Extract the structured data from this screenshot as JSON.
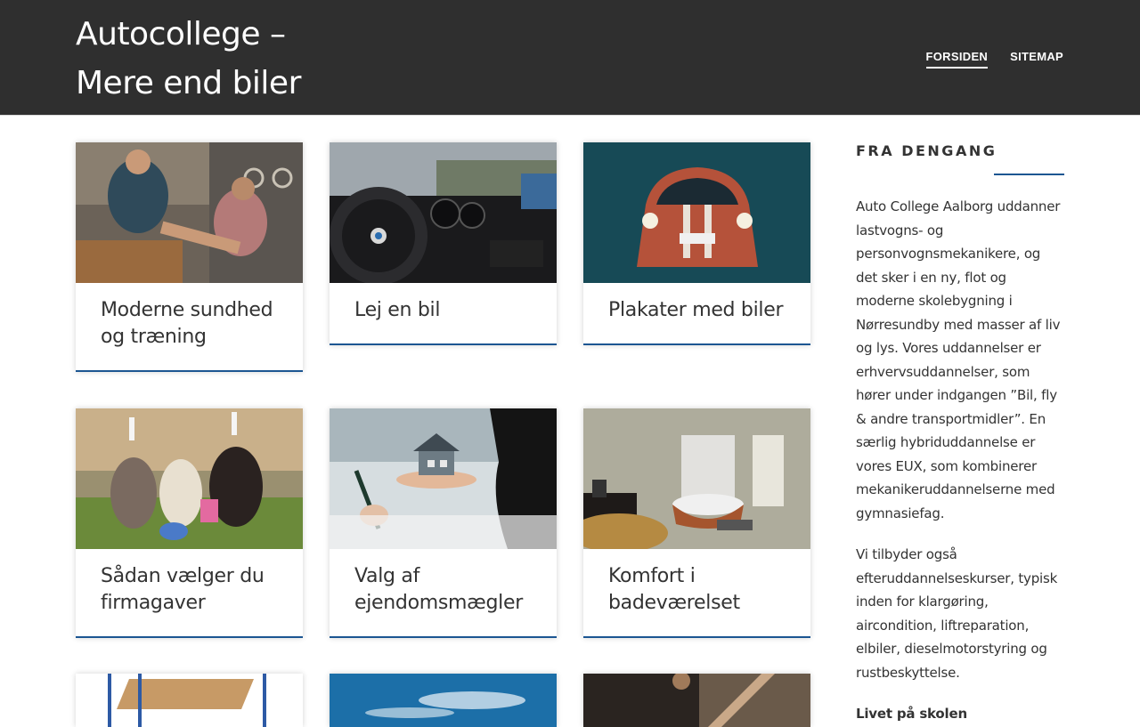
{
  "header": {
    "site_title": "Autocollege – Mere end biler",
    "nav": [
      {
        "label": "FORSIDEN",
        "active": true
      },
      {
        "label": "SITEMAP",
        "active": false
      }
    ]
  },
  "posts": [
    {
      "title": "Moderne sundhed og træning",
      "image": "fitness-trainer-photo"
    },
    {
      "title": "Lej en bil",
      "image": "car-dashboard-photo"
    },
    {
      "title": "Plakater med biler",
      "image": "race-car-poster-photo"
    },
    {
      "title": "Sådan vælger du firmagaver",
      "image": "easter-dogs-photo"
    },
    {
      "title": "Valg af ejendomsmægler",
      "image": "house-in-hand-photo"
    },
    {
      "title": "Komfort i badeværelset",
      "image": "bathtub-photo"
    }
  ],
  "sidebar": {
    "widget_title": "FRA DENGANG",
    "paragraph_1": "Auto College Aalborg uddanner lastvogns- og personvognsmekanikere, og det sker i en ny, flot og moderne skolebygning i Nørresundby med masser af liv og lys. Vores uddannelser er erhvervsuddannelser, som hører under indgangen ”Bil, fly & andre transportmidler”. En særlig hybriduddannelse er vores EUX, som kombinerer mekanikeruddannelserne med gymnasiefag.",
    "paragraph_2": "Vi tilbyder også efteruddannelseskurser, typisk inden for klargøring, aircondition, liftreparation, elbiler, dieselmotorstyring og rustbeskyttelse.",
    "paragraph_3": "Livet på skolen"
  }
}
